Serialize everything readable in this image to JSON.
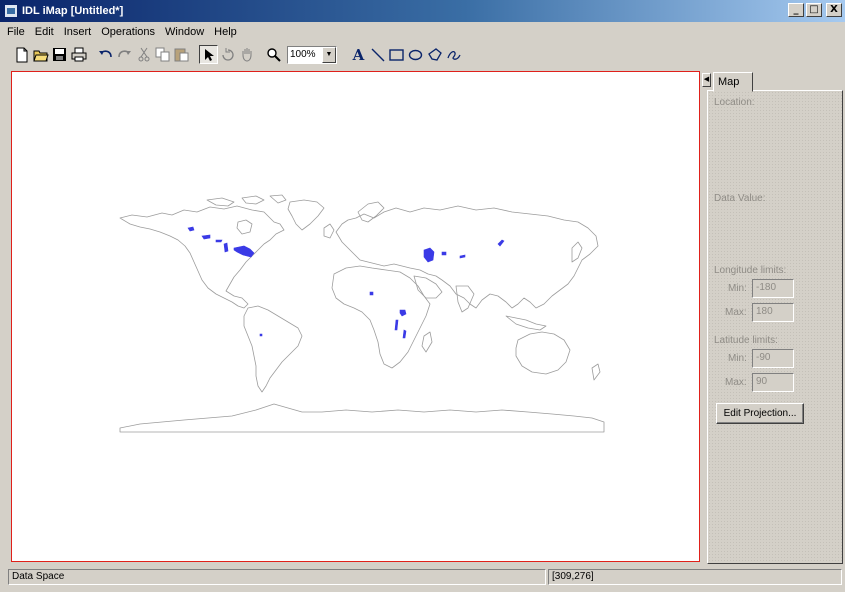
{
  "window": {
    "title": "IDL iMap [Untitled*]",
    "controls": [
      "_",
      "□",
      "X"
    ]
  },
  "menu": [
    "File",
    "Edit",
    "Insert",
    "Operations",
    "Window",
    "Help"
  ],
  "toolbar": {
    "zoom": "100%",
    "icons": [
      "new-file-icon",
      "open-folder-icon",
      "save-icon",
      "print-icon",
      "undo-icon",
      "redo-icon",
      "cut-icon",
      "copy-icon",
      "paste-icon",
      "select-arrow-icon",
      "rotate-icon",
      "pan-hand-icon",
      "zoom-icon",
      "text-icon",
      "line-icon",
      "rectangle-icon",
      "ellipse-icon",
      "polygon-icon",
      "freehand-icon"
    ],
    "text_tool_glyph": "A"
  },
  "panel": {
    "tab": "Map",
    "location_label": "Location:",
    "data_value_label": "Data Value:",
    "longitude_label": "Longitude limits:",
    "lon_min_label": "Min:",
    "lon_min": "-180",
    "lon_max_label": "Max:",
    "lon_max": "180",
    "latitude_label": "Latitude limits:",
    "lat_min_label": "Min:",
    "lat_min": "-90",
    "lat_max_label": "Max:",
    "lat_max": "90",
    "edit_projection": "Edit Projection..."
  },
  "status": {
    "left": "Data Space",
    "coords": "[309,276]"
  },
  "colors": {
    "coastline": "#9c9c9c",
    "lakes": "#3a3ae6",
    "canvas_border": "#e0201a",
    "titlebar": "#0a246a"
  }
}
